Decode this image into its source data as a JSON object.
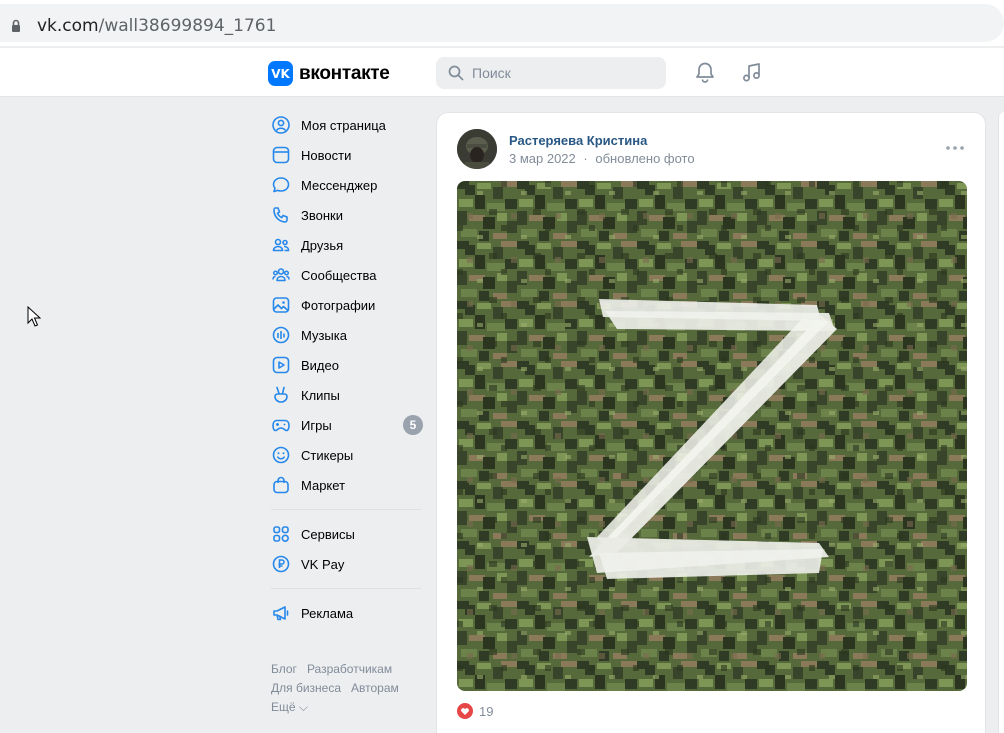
{
  "browser": {
    "url_host": "vk.com",
    "url_path": "/wall38699894_1761"
  },
  "header": {
    "logo_text": "вконтакте",
    "search_placeholder": "Поиск",
    "icons": [
      "search-icon",
      "bell-icon",
      "music-icon"
    ]
  },
  "sidebar": {
    "items": [
      {
        "label": "Моя страница",
        "icon": "user-circle-icon"
      },
      {
        "label": "Новости",
        "icon": "newsfeed-icon"
      },
      {
        "label": "Мессенджер",
        "icon": "message-icon"
      },
      {
        "label": "Звонки",
        "icon": "phone-icon"
      },
      {
        "label": "Друзья",
        "icon": "friends-icon"
      },
      {
        "label": "Сообщества",
        "icon": "communities-icon"
      },
      {
        "label": "Фотографии",
        "icon": "photo-icon"
      },
      {
        "label": "Музыка",
        "icon": "music-icon"
      },
      {
        "label": "Видео",
        "icon": "video-icon"
      },
      {
        "label": "Клипы",
        "icon": "clips-icon"
      },
      {
        "label": "Игры",
        "icon": "gamepad-icon",
        "badge": "5"
      },
      {
        "label": "Стикеры",
        "icon": "smile-icon"
      },
      {
        "label": "Маркет",
        "icon": "bag-icon"
      }
    ],
    "items2": [
      {
        "label": "Сервисы",
        "icon": "services-icon"
      },
      {
        "label": "VK Pay",
        "icon": "ruble-icon"
      }
    ],
    "items3": [
      {
        "label": "Реклама",
        "icon": "megaphone-icon"
      }
    ],
    "footer": {
      "blog": "Блог",
      "developers": "Разработчикам",
      "business": "Для бизнеса",
      "authors": "Авторам",
      "more": "Ещё ⌵"
    }
  },
  "post": {
    "author": "Растеряева Кристина",
    "date": "3 мар 2022",
    "separator": "·",
    "action": "обновлено фото",
    "likes_count": "19"
  },
  "colors": {
    "accent": "#0077ff",
    "link": "#2a5885",
    "icon": "#2688eb",
    "like": "#e64646"
  }
}
